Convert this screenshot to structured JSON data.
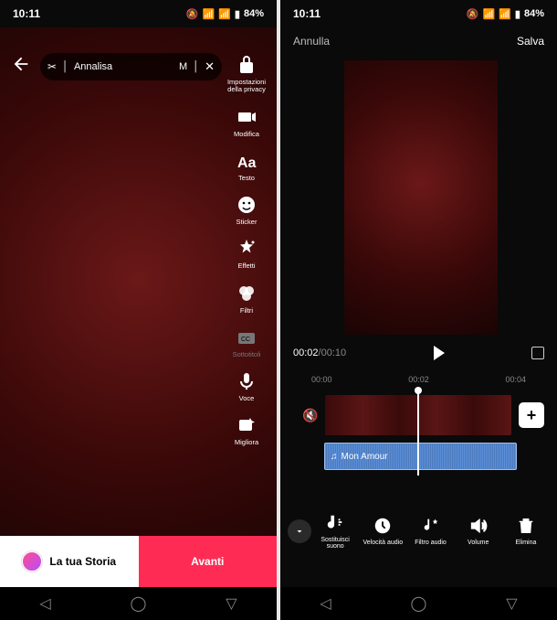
{
  "status": {
    "time": "10:11",
    "battery": "84%"
  },
  "left": {
    "music_pill": {
      "track": "Annalisa",
      "extra": "M"
    },
    "tools": [
      {
        "key": "privacy",
        "label": "Impostazioni della privacy"
      },
      {
        "key": "edit",
        "label": "Modifica"
      },
      {
        "key": "text",
        "label": "Testo"
      },
      {
        "key": "sticker",
        "label": "Sticker"
      },
      {
        "key": "effects",
        "label": "Effetti"
      },
      {
        "key": "filters",
        "label": "Filtri"
      },
      {
        "key": "captions",
        "label": "Sottotitoli"
      },
      {
        "key": "voice",
        "label": "Voce"
      },
      {
        "key": "enhance",
        "label": "Migliora"
      }
    ],
    "story_button": "La tua Storia",
    "next_button": "Avanti"
  },
  "right": {
    "cancel": "Annulla",
    "save": "Salva",
    "current_time": "00:02",
    "duration": "00:10",
    "ticks": [
      "00:00",
      "00:02",
      "00:04"
    ],
    "audio_clip": "Mon Amour",
    "tools": [
      {
        "key": "replace-sound",
        "label": "Sostituisci suono"
      },
      {
        "key": "speed",
        "label": "Velocità audio"
      },
      {
        "key": "audio-filter",
        "label": "Filtro audio"
      },
      {
        "key": "volume",
        "label": "Volume"
      },
      {
        "key": "delete",
        "label": "Elimina"
      }
    ]
  }
}
